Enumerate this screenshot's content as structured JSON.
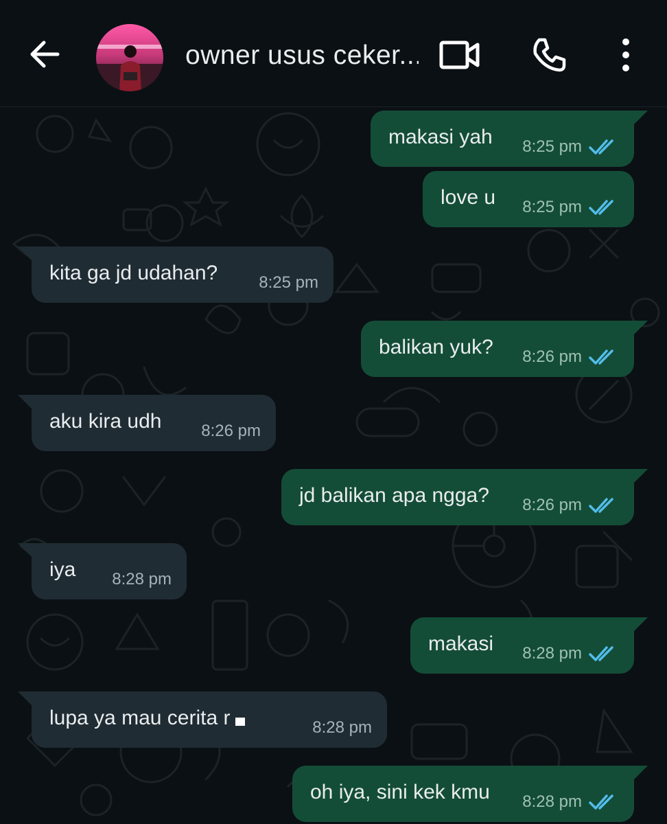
{
  "header": {
    "contact_name": "owner usus ceker...",
    "icons": {
      "back": "arrow-left",
      "video": "video-camera",
      "call": "phone",
      "menu": "vertical-ellipsis"
    }
  },
  "colors": {
    "outgoing_bubble": "#144d37",
    "incoming_bubble": "#202c33",
    "read_ticks": "#53bdeb",
    "background": "#0b1014"
  },
  "messages": [
    {
      "direction": "out",
      "text": "makasi yah",
      "time": "8:25 pm",
      "status": "read"
    },
    {
      "direction": "out",
      "text": "love u",
      "time": "8:25 pm",
      "status": "read"
    },
    {
      "direction": "in",
      "text": "kita ga jd udahan?",
      "time": "8:25 pm"
    },
    {
      "direction": "out",
      "text": "balikan yuk?",
      "time": "8:26 pm",
      "status": "read"
    },
    {
      "direction": "in",
      "text": "aku kira udh",
      "time": "8:26 pm"
    },
    {
      "direction": "out",
      "text": "jd balikan apa ngga?",
      "time": "8:26 pm",
      "status": "read"
    },
    {
      "direction": "in",
      "text": "iya",
      "time": "8:28 pm"
    },
    {
      "direction": "out",
      "text": "makasi",
      "time": "8:28 pm",
      "status": "read"
    },
    {
      "direction": "in",
      "text": "lupa ya mau cerita r",
      "time": "8:28 pm"
    },
    {
      "direction": "out",
      "text": "oh iya, sini kek kmu",
      "time": "8:28 pm",
      "status": "read"
    }
  ]
}
